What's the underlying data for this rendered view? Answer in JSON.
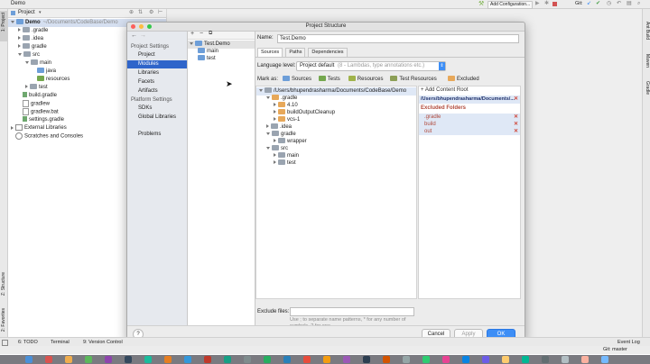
{
  "window": {
    "title": "Demo"
  },
  "toolbar": {
    "run_config": "Add Configuration...",
    "git_label": "Git:"
  },
  "project_pane": {
    "header": "Project",
    "items": [
      {
        "label": "Demo",
        "extra": "~/Documents/CodeBase/Demo",
        "icon": "module-folder-icon",
        "level": 0,
        "expanded": true
      },
      {
        "label": ".gradle",
        "icon": "folder-icon",
        "level": 1,
        "expanded": false
      },
      {
        "label": ".idea",
        "icon": "folder-icon",
        "level": 1,
        "expanded": false
      },
      {
        "label": "gradle",
        "icon": "folder-icon",
        "level": 1,
        "expanded": false
      },
      {
        "label": "src",
        "icon": "folder-icon",
        "level": 1,
        "expanded": true
      },
      {
        "label": "main",
        "icon": "folder-icon",
        "level": 2,
        "expanded": true
      },
      {
        "label": "java",
        "icon": "source-folder-icon",
        "level": 3
      },
      {
        "label": "resources",
        "icon": "resource-folder-icon",
        "level": 3
      },
      {
        "label": "test",
        "icon": "folder-icon",
        "level": 2,
        "expanded": false
      },
      {
        "label": "build.gradle",
        "icon": "gradle-file-icon",
        "level": 1
      },
      {
        "label": "gradlew",
        "icon": "file-icon",
        "level": 1
      },
      {
        "label": "gradlew.bat",
        "icon": "file-icon",
        "level": 1
      },
      {
        "label": "settings.gradle",
        "icon": "gradle-file-icon",
        "level": 1
      },
      {
        "label": "External Libraries",
        "icon": "library-icon",
        "level": 0,
        "expanded": false
      },
      {
        "label": "Scratches and Consoles",
        "icon": "scratch-icon",
        "level": 0
      }
    ]
  },
  "left_tool_strip": {
    "project": "1: Project",
    "structure": "Z: Structure",
    "favorites": "2: Favorites"
  },
  "right_tool_strip": {
    "ant": "Ant Build",
    "maven": "Maven",
    "gradle": "Gradle"
  },
  "bottom_bar": {
    "todo": "6: TODO",
    "terminal": "Terminal",
    "vcs": "9: Version Control",
    "event_log": "Event Log",
    "git_status": "Git: master"
  },
  "dialog": {
    "title": "Project Structure",
    "project_settings_header": "Project Settings",
    "project_settings": [
      "Project",
      "Modules",
      "Libraries",
      "Facets",
      "Artifacts"
    ],
    "selected_setting": "Modules",
    "platform_settings_header": "Platform Settings",
    "platform_settings": [
      "SDKs",
      "Global Libraries"
    ],
    "problems": "Problems",
    "module_tree": [
      {
        "label": "Test.Demo",
        "level": 0
      },
      {
        "label": "main",
        "level": 1
      },
      {
        "label": "test",
        "level": 1
      }
    ],
    "name_label": "Name:",
    "name_value": "Test.Demo",
    "tabs": [
      "Sources",
      "Paths",
      "Dependencies"
    ],
    "active_tab": "Sources",
    "language_level_label": "Language level:",
    "language_level_value": "Project default",
    "language_level_hint": "(8 - Lambdas, type annotations etc.)",
    "mark_as_label": "Mark as:",
    "mark_as": [
      "Sources",
      "Tests",
      "Resources",
      "Test Resources",
      "Excluded"
    ],
    "content_tree": [
      {
        "label": "/Users/bhupendrasharma/Documents/CodeBase/Demo",
        "level": 0,
        "expanded": true,
        "color": "gray"
      },
      {
        "label": ".gradle",
        "level": 1,
        "expanded": true,
        "color": "orange"
      },
      {
        "label": "4.10",
        "level": 2,
        "expanded": false,
        "color": "orange"
      },
      {
        "label": "buildOutputCleanup",
        "level": 2,
        "expanded": false,
        "color": "orange"
      },
      {
        "label": "vcs-1",
        "level": 2,
        "expanded": false,
        "color": "orange"
      },
      {
        "label": ".idea",
        "level": 1,
        "expanded": false,
        "color": "gray"
      },
      {
        "label": "gradle",
        "level": 1,
        "expanded": true,
        "color": "gray"
      },
      {
        "label": "wrapper",
        "level": 2,
        "expanded": false,
        "color": "gray"
      },
      {
        "label": "src",
        "level": 1,
        "expanded": true,
        "color": "gray"
      },
      {
        "label": "main",
        "level": 2,
        "expanded": false,
        "color": "gray"
      },
      {
        "label": "test",
        "level": 2,
        "expanded": false,
        "color": "gray"
      }
    ],
    "add_content_root": "+ Add Content Root",
    "content_root_path": "/Users/bhupendrasharma/Documents/...",
    "excluded_header": "Excluded Folders",
    "excluded_folders": [
      ".gradle",
      "build",
      "out"
    ],
    "exclude_files_label": "Exclude files:",
    "exclude_files_hint": "Use ; to separate name patterns, * for any number of symbols, ? for one.",
    "help": "?",
    "cancel": "Cancel",
    "apply": "Apply",
    "ok": "OK"
  },
  "colors": {
    "accent": "#3d8ef6",
    "selection": "#2f65ca",
    "excluded": "#d0483b",
    "source": "#6d9ed8",
    "resource": "#74a74e",
    "excluded_folder": "#e7a85a"
  }
}
